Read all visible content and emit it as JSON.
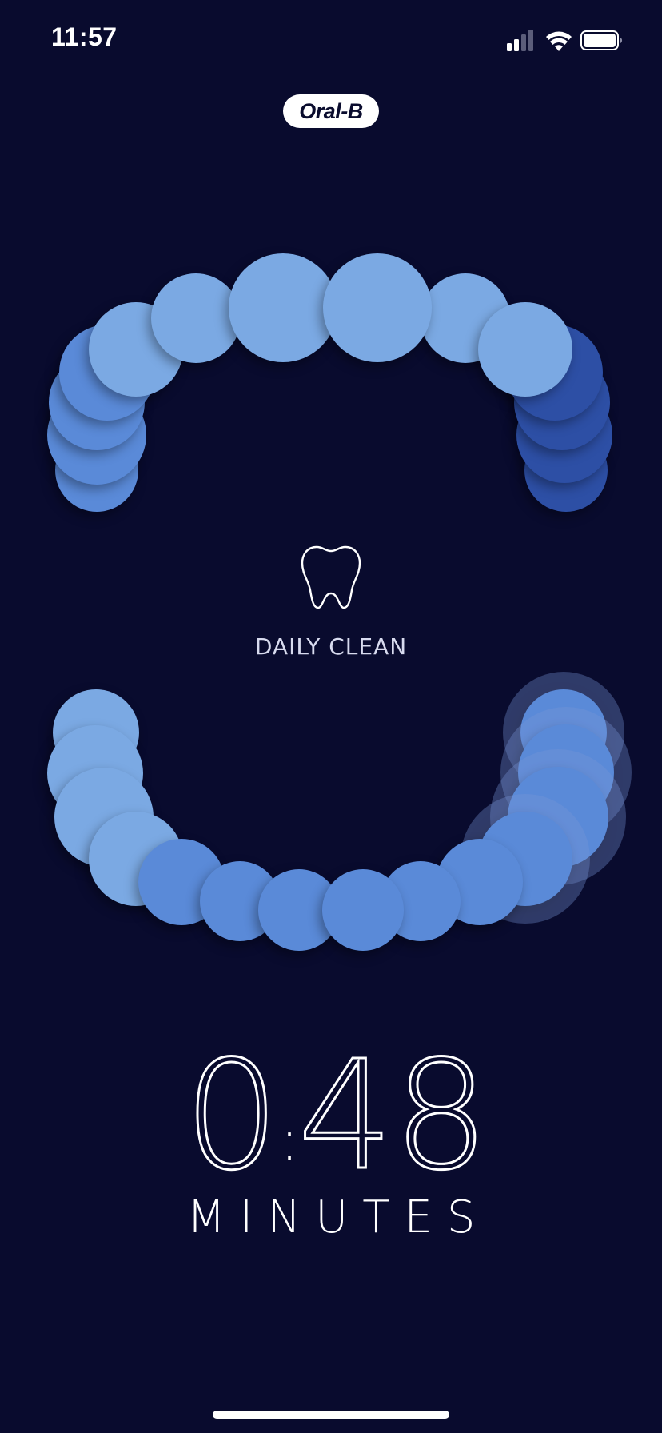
{
  "status_bar": {
    "time": "11:57",
    "icons": [
      "cellular-signal-icon",
      "wifi-icon",
      "battery-icon"
    ]
  },
  "brand": {
    "logo_text": "Oral-B"
  },
  "mode": {
    "label": "DAILY CLEAN",
    "icon": "tooth-icon"
  },
  "timer": {
    "minutes": "0",
    "separator": ":",
    "seconds": "48",
    "unit": "MINUTES"
  },
  "colors": {
    "background": "#090b2e",
    "zone_light": "#7ba9e3",
    "zone_medium": "#5a8ad8",
    "zone_dark": "#2d4fa5",
    "text": "#ffffff"
  }
}
